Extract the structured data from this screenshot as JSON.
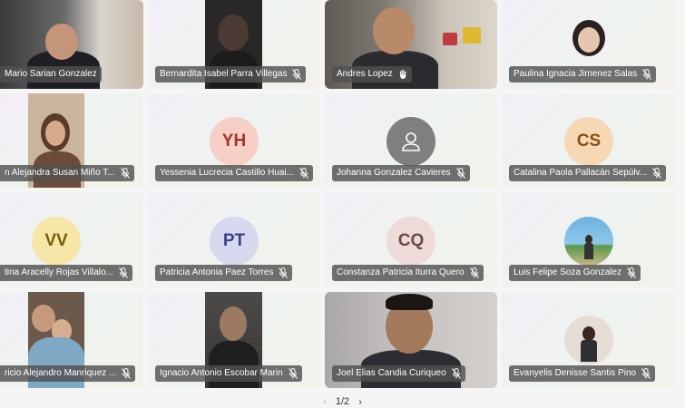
{
  "participants": [
    {
      "name": "Mario Sarian Gonzalez",
      "label_shown": "Mario Sarian Gonzalez"
    },
    {
      "name": "Bernardita Isabel Parra Villegas",
      "label_shown": "Bernardita Isabel Parra Villegas"
    },
    {
      "name": "Andres Lopez",
      "label_shown": "Andres Lopez"
    },
    {
      "name": "Paulina Ignacia Jimenez Salas",
      "label_shown": "Paulina Ignacia Jimenez Salas"
    },
    {
      "name": "n Alejandra Susan Miño T...",
      "label_shown": "n Alejandra Susan Miño T..."
    },
    {
      "name": "Yessenia Lucrecia Castillo Huai...",
      "label_shown": "Yessenia Lucrecia Castillo Huai...",
      "initials": "YH"
    },
    {
      "name": "Johanna Gonzalez Cavieres",
      "label_shown": "Johanna Gonzalez Cavieres"
    },
    {
      "name": "Catalina Paola Pallacán Sepúlv...",
      "label_shown": "Catalina Paola Pallacán Sepúlv...",
      "initials": "CS"
    },
    {
      "name": "tina Aracelly Rojas Villalo...",
      "label_shown": "tina Aracelly Rojas Villalo...",
      "initials": "VV"
    },
    {
      "name": "Patricia Antonia Paez Torres",
      "label_shown": "Patricia Antonia Paez Torres",
      "initials": "PT"
    },
    {
      "name": "Constanza Patricia Iturra Quero",
      "label_shown": "Constanza Patricia Iturra Quero",
      "initials": "CQ"
    },
    {
      "name": "Luis Felipe Soza Gonzalez",
      "label_shown": "Luis Felipe Soza Gonzalez"
    },
    {
      "name": "ricio Alejandro Manriquez ...",
      "label_shown": "ricio Alejandro Manriquez ..."
    },
    {
      "name": "Ignacio Antonio Escobar Marin",
      "label_shown": "Ignacio Antonio Escobar Marin"
    },
    {
      "name": "Joel Elias Candia Curiqueo",
      "label_shown": "Joel Elias Candia Curiqueo"
    },
    {
      "name": "Evanyelis Denisse Santis Pino",
      "label_shown": "Evanyelis Denisse Santis Pino"
    }
  ],
  "pager": {
    "label": "1/2",
    "prev_icon": "chevron-left-icon",
    "next_icon": "chevron-right-icon"
  },
  "colors": {
    "name_tag_bg": "#505050",
    "avatar_yh_bg": "#f6cfc6",
    "avatar_yh_fg": "#a2372a",
    "avatar_cs_bg": "#f7d8b4",
    "avatar_cs_fg": "#8a4e12",
    "avatar_vv_bg": "#f6e6a8",
    "avatar_vv_fg": "#7a5f06",
    "avatar_pt_bg": "#d8d9ef",
    "avatar_pt_fg": "#3e3f86",
    "avatar_cq_bg": "#eedad8",
    "avatar_cq_fg": "#6b4a47"
  }
}
